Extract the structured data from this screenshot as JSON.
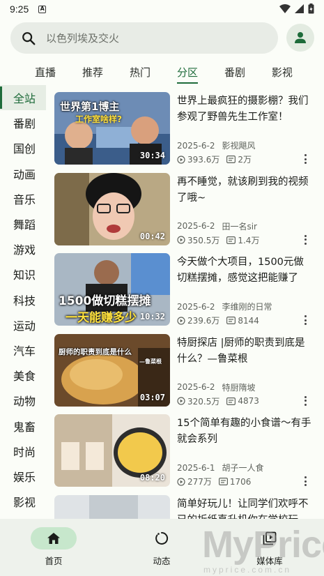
{
  "status_bar": {
    "time": "9:25",
    "indicator": "A"
  },
  "search": {
    "placeholder": "以色列埃及交火"
  },
  "tabs": [
    {
      "label": "直播"
    },
    {
      "label": "推荐"
    },
    {
      "label": "热门"
    },
    {
      "label": "分区",
      "active": true
    },
    {
      "label": "番剧"
    },
    {
      "label": "影视"
    }
  ],
  "sidebar": {
    "items": [
      {
        "label": "全站",
        "active": true
      },
      {
        "label": "番剧"
      },
      {
        "label": "国创"
      },
      {
        "label": "动画"
      },
      {
        "label": "音乐"
      },
      {
        "label": "舞蹈"
      },
      {
        "label": "游戏"
      },
      {
        "label": "知识"
      },
      {
        "label": "科技"
      },
      {
        "label": "运动"
      },
      {
        "label": "汽车"
      },
      {
        "label": "美食"
      },
      {
        "label": "动物"
      },
      {
        "label": "鬼畜"
      },
      {
        "label": "时尚"
      },
      {
        "label": "娱乐"
      },
      {
        "label": "影视"
      }
    ]
  },
  "videos": [
    {
      "title": "世界上最疯狂的摄影棚？我们参观了野兽先生工作室！",
      "duration": "30:34",
      "date": "2025-6-2",
      "uploader": "影视飓风",
      "views": "393.6万",
      "danmaku": "2万",
      "thumb_text_1": "世界第1博主",
      "thumb_text_2": "工作室啥样?"
    },
    {
      "title": "再不睡觉，就该刷到我的视频了哦~",
      "duration": "00:42",
      "date": "2025-6-2",
      "uploader": "田一名sir",
      "views": "350.5万",
      "danmaku": "1.4万"
    },
    {
      "title": "今天做个大项目，1500元做切糕摆摊，感觉这把能赚了",
      "duration": "10:32",
      "date": "2025-6-2",
      "uploader": "李维刚的日常",
      "views": "239.6万",
      "danmaku": "8144",
      "thumb_text_1": "1500做切糕摆摊",
      "thumb_text_2": "一天能赚多少"
    },
    {
      "title": "特厨探店 |厨师的职责到底是什么？—鲁菜根",
      "duration": "03:07",
      "date": "2025-6-2",
      "uploader": "特厨隋坡",
      "views": "320.5万",
      "danmaku": "4873",
      "thumb_text_1": "厨师的职责到底是什么",
      "thumb_text_2": "—鲁菜根"
    },
    {
      "title": "15个简单有趣的小食谱～有手就会系列",
      "duration": "08:20",
      "date": "2025-6-1",
      "uploader": "胡子一人食",
      "views": "277万",
      "danmaku": "1706"
    },
    {
      "title": "简单好玩儿！让同学们欢呼不已的折纸直升机你在学校玩…",
      "duration": "",
      "date": "",
      "uploader": "",
      "views": "",
      "danmaku": ""
    }
  ],
  "bottom_nav": [
    {
      "label": "首页",
      "icon": "home-icon",
      "active": true
    },
    {
      "label": "动态",
      "icon": "dynamic-icon"
    },
    {
      "label": "媒体库",
      "icon": "library-icon"
    }
  ],
  "watermark": {
    "big": "MyPrice",
    "small": "myprice.com.cn"
  },
  "colors": {
    "accent": "#1e6b3a",
    "nav_pill": "#c7e7cc",
    "search_bg": "#e8ece6"
  }
}
